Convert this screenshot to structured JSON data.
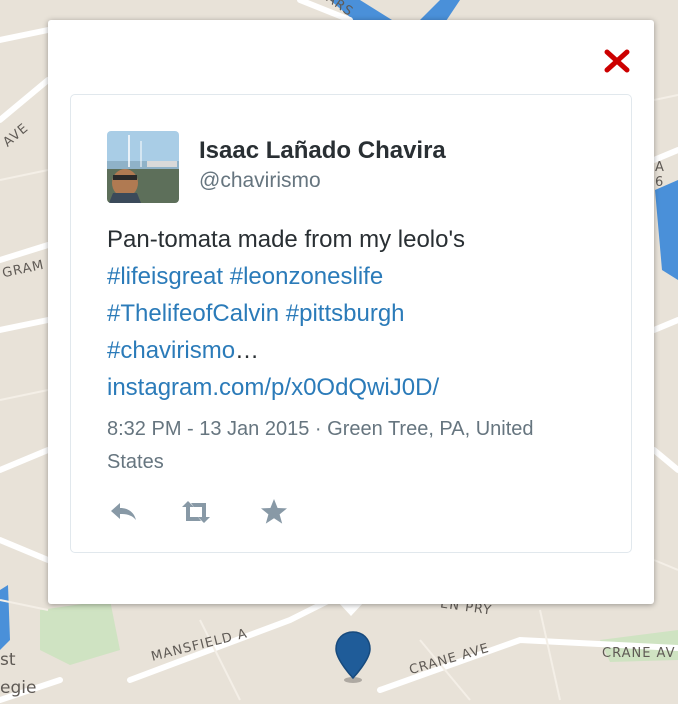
{
  "map": {
    "streets": [
      "MANSFIELD A",
      "CRANE AVE",
      "CRANE AV",
      "GRAM",
      "AVE",
      "A 6",
      "EN PRY",
      "ARS"
    ],
    "places": [
      "st",
      "egie"
    ],
    "colors": {
      "land": "#e8e2d8",
      "water": "#4a90d9",
      "park": "#cfe3c2",
      "road": "#ffffff"
    }
  },
  "popup": {
    "close_icon": "close-x-icon",
    "close_color": "#cc0000"
  },
  "tweet": {
    "author_name": "Isaac Lañado Chavira",
    "author_handle": "@chavirismo",
    "text_plain": "Pan-tomata made from my leolo's",
    "hashtags": [
      "#lifeisgreat",
      "#leonzoneslife",
      "#ThelifeofCalvin",
      "#pittsburgh",
      "#chavirismo"
    ],
    "ellipsis": "…",
    "link": "instagram.com/p/x0OdQwiJ0D/",
    "timestamp": "8:32 PM - 13 Jan 2015",
    "separator": "·",
    "location": "Green Tree, PA, United States",
    "actions": [
      "reply-icon",
      "retweet-icon",
      "favorite-star-icon"
    ]
  },
  "marker": {
    "icon": "map-pin-icon",
    "color": "#1f5c99"
  }
}
